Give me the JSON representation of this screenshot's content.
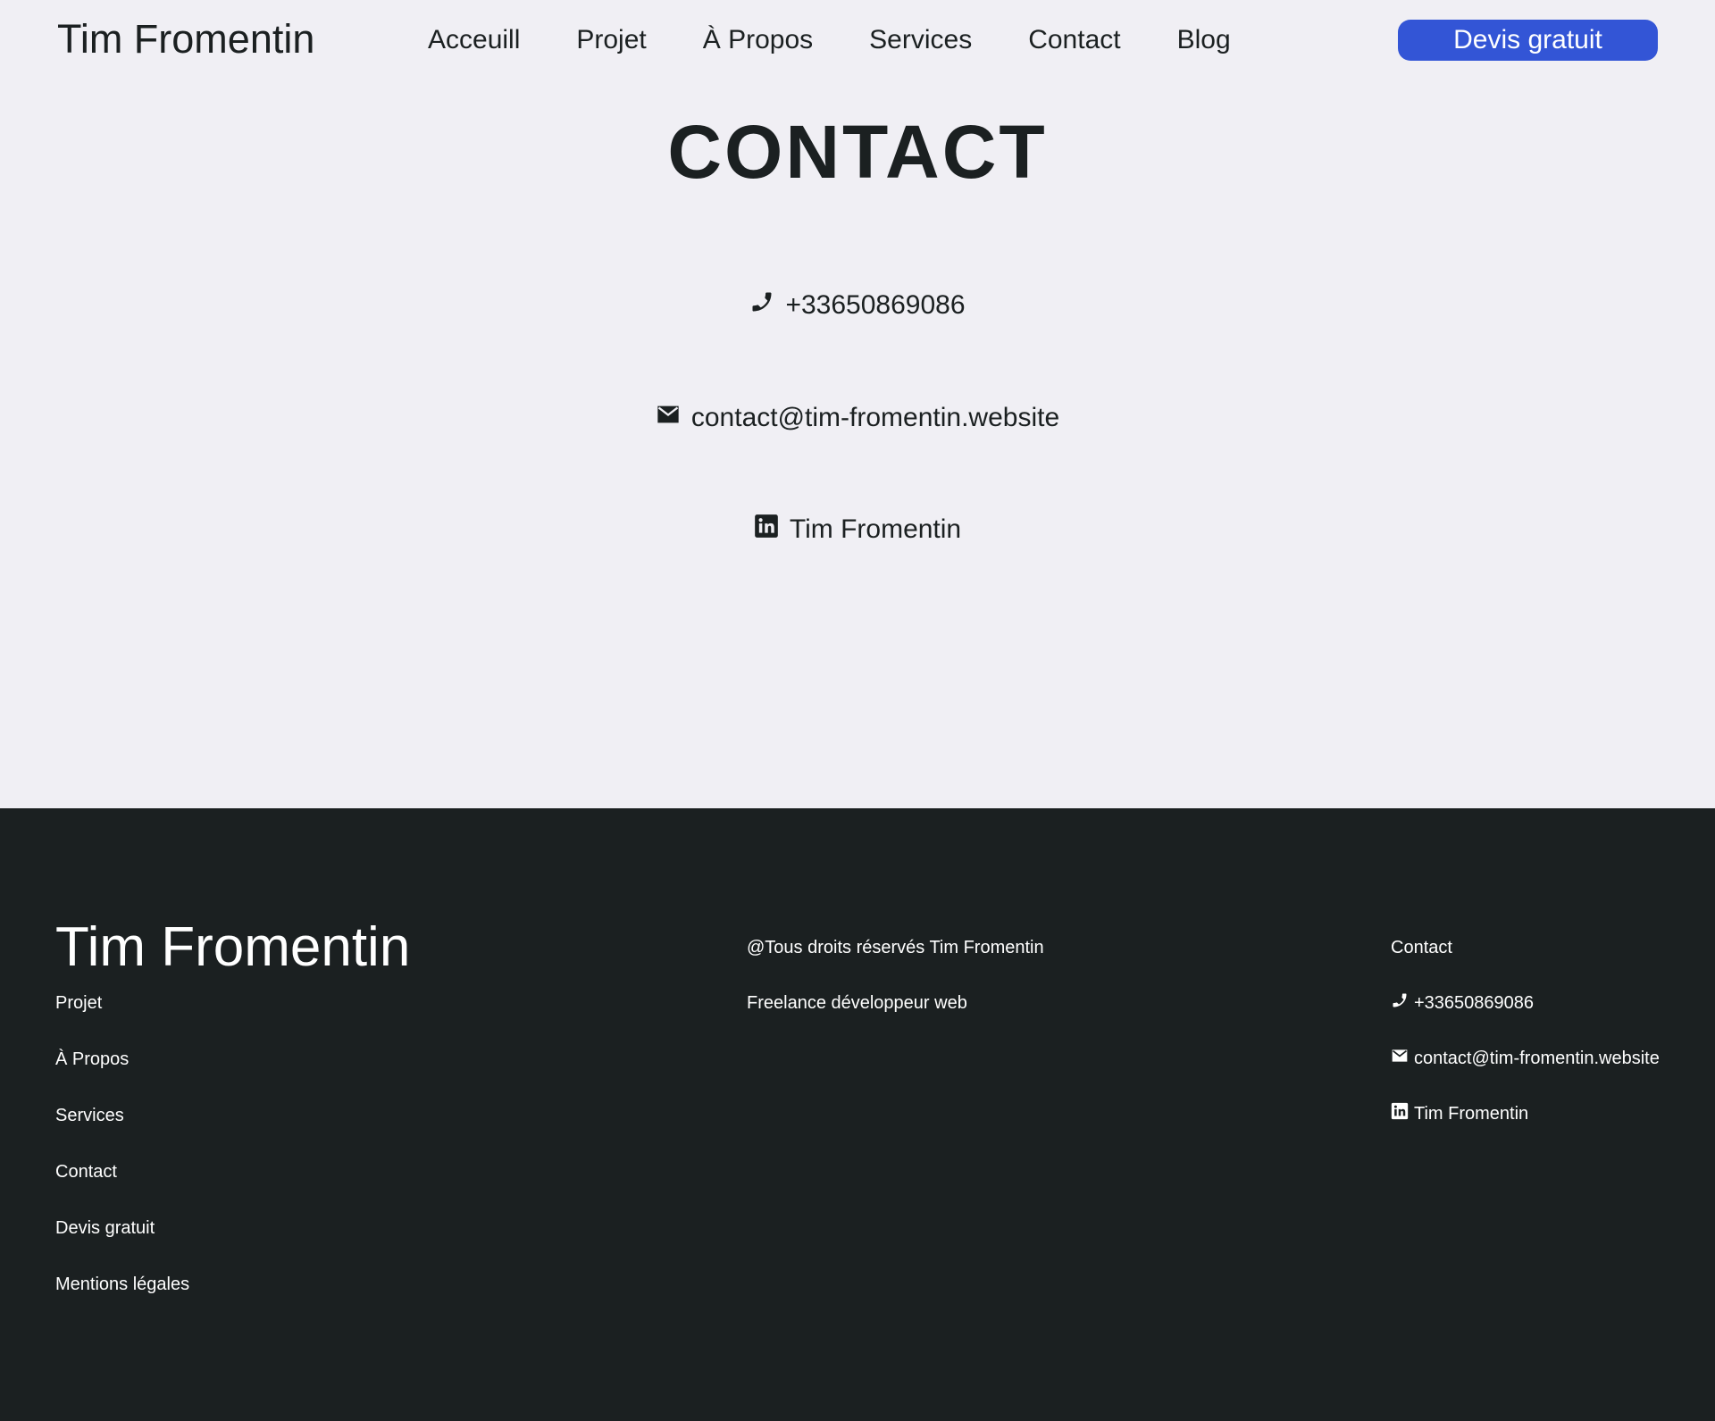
{
  "header": {
    "logo": "Tim Fromentin",
    "nav": [
      "Acceuill",
      "Projet",
      "À Propos",
      "Services",
      "Contact",
      "Blog"
    ],
    "cta_label": "Devis gratuit"
  },
  "main": {
    "title": "CONTACT",
    "phone": "+33650869086",
    "email": "contact@tim-fromentin.website",
    "linkedin": "Tim Fromentin",
    "icons": [
      "phone-icon",
      "mail-icon",
      "linkedin-icon"
    ]
  },
  "footer": {
    "logo": "Tim Fromentin",
    "links": [
      "Projet",
      "À Propos",
      "Services",
      "Contact",
      "Devis gratuit",
      "Mentions légales"
    ],
    "copyright": "@Tous droits réservés Tim Fromentin",
    "tagline": "Freelance développeur web",
    "contact_heading": "Contact",
    "phone": "+33650869086",
    "email": "contact@tim-fromentin.website",
    "linkedin": "Tim Fromentin"
  },
  "colors": {
    "page_background": "#f0eff4",
    "text": "#1b2021",
    "accent": "#3355d6",
    "footer_background": "#1b2021"
  }
}
